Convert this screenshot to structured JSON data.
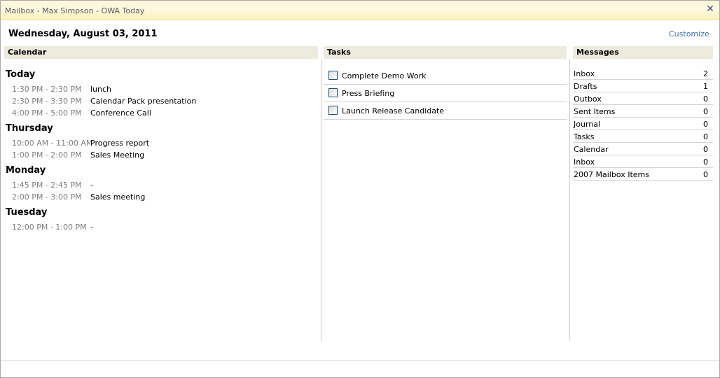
{
  "window": {
    "title": "Mailbox - Max Simpson - OWA Today",
    "close_glyph": "✕"
  },
  "header": {
    "date": "Wednesday, August 03, 2011",
    "customize_label": "Customize"
  },
  "calendar": {
    "heading": "Calendar",
    "days": [
      {
        "label": "Today",
        "appointments": [
          {
            "time": "1:30 PM - 2:30 PM",
            "subject": "lunch"
          },
          {
            "time": "2:30 PM - 3:30 PM",
            "subject": "Calendar Pack presentation"
          },
          {
            "time": "4:00 PM - 5:00 PM",
            "subject": "Conference Call"
          }
        ]
      },
      {
        "label": "Thursday",
        "appointments": [
          {
            "time": "10:00 AM - 11:00 AM",
            "subject": "Progress report"
          },
          {
            "time": "1:00 PM - 2:00 PM",
            "subject": "Sales Meeting"
          }
        ]
      },
      {
        "label": "Monday",
        "appointments": [
          {
            "time": "1:45 PM - 2:45 PM",
            "subject": "-"
          },
          {
            "time": "2:00 PM - 3:00 PM",
            "subject": "Sales meeting"
          }
        ]
      },
      {
        "label": "Tuesday",
        "appointments": [
          {
            "time": "12:00 PM - 1:00 PM",
            "subject": "-"
          }
        ]
      }
    ]
  },
  "tasks": {
    "heading": "Tasks",
    "items": [
      {
        "label": "Complete Demo Work",
        "checked": false
      },
      {
        "label": "Press Briefing",
        "checked": false
      },
      {
        "label": "Launch Release Candidate",
        "checked": false
      }
    ]
  },
  "messages": {
    "heading": "Messages",
    "folders": [
      {
        "name": "Inbox",
        "count": "2"
      },
      {
        "name": "Drafts",
        "count": "1"
      },
      {
        "name": "Outbox",
        "count": "0"
      },
      {
        "name": "Sent Items",
        "count": "0"
      },
      {
        "name": "Journal",
        "count": "0"
      },
      {
        "name": "Tasks",
        "count": "0"
      },
      {
        "name": "Calendar",
        "count": "0"
      },
      {
        "name": "Inbox",
        "count": "0"
      },
      {
        "name": "2007 Mailbox Items",
        "count": "0"
      }
    ]
  },
  "colors": {
    "panel_header_bg": "#ecebde",
    "link": "#3f6fb0",
    "time_text": "#7f7f7f"
  }
}
